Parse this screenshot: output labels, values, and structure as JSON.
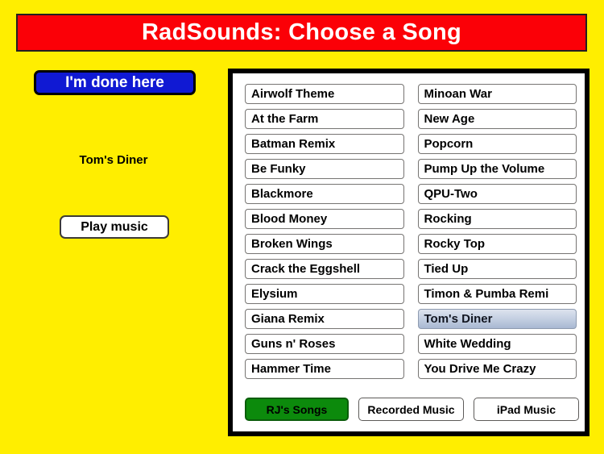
{
  "header": {
    "title": "RadSounds: Choose a Song",
    "background_color": "#fb0007",
    "text_color": "#ffffff"
  },
  "app": {
    "background_color": "#ffee00"
  },
  "sidebar": {
    "done_button_label": "I'm done here",
    "done_button_color": "#1019d3",
    "now_playing": "Tom's Diner",
    "play_button_label": "Play music"
  },
  "song_panel": {
    "columns": [
      {
        "items": [
          {
            "label": "Airwolf Theme",
            "selected": false
          },
          {
            "label": "At the Farm",
            "selected": false
          },
          {
            "label": "Batman Remix",
            "selected": false
          },
          {
            "label": "Be Funky",
            "selected": false
          },
          {
            "label": "Blackmore",
            "selected": false
          },
          {
            "label": "Blood Money",
            "selected": false
          },
          {
            "label": "Broken Wings",
            "selected": false
          },
          {
            "label": "Crack the Eggshell",
            "selected": false
          },
          {
            "label": "Elysium",
            "selected": false
          },
          {
            "label": "Giana Remix",
            "selected": false
          },
          {
            "label": "Guns n' Roses",
            "selected": false
          },
          {
            "label": "Hammer Time",
            "selected": false
          }
        ]
      },
      {
        "items": [
          {
            "label": "Minoan War",
            "selected": false
          },
          {
            "label": "New Age",
            "selected": false
          },
          {
            "label": "Popcorn",
            "selected": false
          },
          {
            "label": "Pump Up the Volume",
            "selected": false
          },
          {
            "label": "QPU-Two",
            "selected": false
          },
          {
            "label": "Rocking",
            "selected": false
          },
          {
            "label": "Rocky Top",
            "selected": false
          },
          {
            "label": "Tied Up",
            "selected": false
          },
          {
            "label": "Timon & Pumba Remi",
            "selected": false
          },
          {
            "label": "Tom's Diner",
            "selected": true
          },
          {
            "label": "White Wedding",
            "selected": false
          },
          {
            "label": "You Drive Me Crazy",
            "selected": false
          }
        ]
      }
    ]
  },
  "tabs": [
    {
      "label": "RJ's Songs",
      "active": true,
      "id": "tab-rj",
      "active_color": "#0c8a0c"
    },
    {
      "label": "Recorded Music",
      "active": false,
      "id": "tab-recorded"
    },
    {
      "label": "iPad Music",
      "active": false,
      "id": "tab-ipad"
    }
  ]
}
